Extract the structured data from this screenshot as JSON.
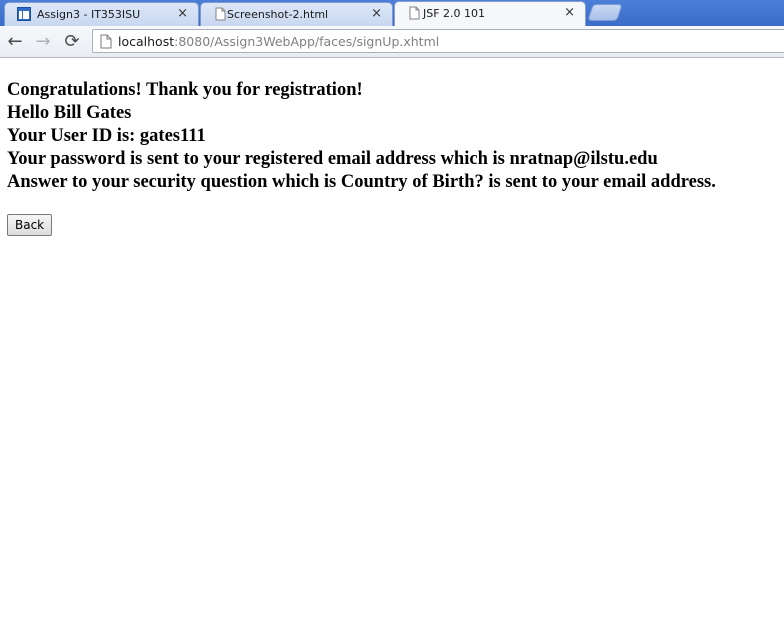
{
  "browser": {
    "tabs": [
      {
        "title": "Assign3 - IT353ISU",
        "icon": "app-window-icon",
        "close": "×"
      },
      {
        "title": "Screenshot-2.html",
        "icon": "page-icon",
        "close": "×"
      },
      {
        "title": "JSF 2.0 101",
        "icon": "page-icon",
        "close": "×",
        "active": true
      }
    ],
    "address": {
      "host": "localhost",
      "rest": ":8080/Assign3WebApp/faces/signUp.xhtml"
    },
    "nav": {
      "back": "←",
      "forward": "→",
      "reload": "⟳"
    }
  },
  "page": {
    "messages": [
      "Congratulations! Thank you for registration!",
      "Hello Bill Gates",
      "Your User ID is: gates111",
      "Your password is sent to your registered email address which is nratnap@ilstu.edu",
      "Answer to your security question which is Country of Birth? is sent to your email address."
    ],
    "back_button": "Back"
  }
}
